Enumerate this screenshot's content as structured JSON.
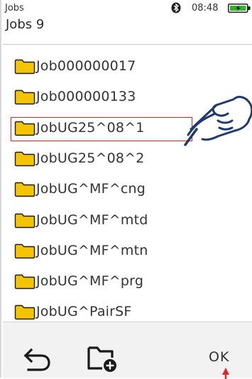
{
  "status_bar": {
    "title": "Jobs",
    "time": "08:48",
    "bluetooth_icon": "bluetooth-icon",
    "battery_icon": "battery-charging-icon"
  },
  "header": {
    "title": "Jobs 9"
  },
  "jobs": {
    "items": [
      {
        "label": "Job000000017",
        "selected": false
      },
      {
        "label": "Job000000133",
        "selected": false
      },
      {
        "label": "JobUG25^08^1",
        "selected": true
      },
      {
        "label": "JobUG25^08^2",
        "selected": false
      },
      {
        "label": "JobUG^MF^cng",
        "selected": false
      },
      {
        "label": "JobUG^MF^mtd",
        "selected": false
      },
      {
        "label": "JobUG^MF^mtn",
        "selected": false
      },
      {
        "label": "JobUG^MF^prg",
        "selected": false
      },
      {
        "label": "JobUG^PairSF",
        "selected": false
      }
    ]
  },
  "toolbar": {
    "back_icon": "back-arrow-icon",
    "new_folder_icon": "new-folder-icon",
    "ok_label": "OK"
  },
  "colors": {
    "folder": "#f5c400",
    "folder_outline": "#1d1d1d",
    "selection": "#e2232a",
    "battery_fill": "#2fb52a"
  }
}
